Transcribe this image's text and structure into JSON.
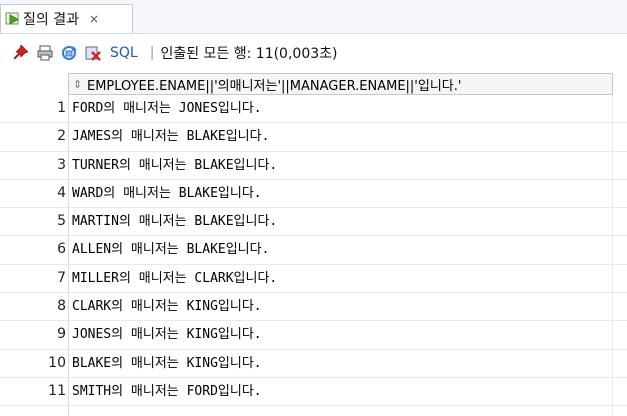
{
  "tab": {
    "label": "질의 결과",
    "close": "×",
    "icon": "run-query-icon"
  },
  "toolbar": {
    "pin_icon": "pin-icon",
    "print_icon": "print-icon",
    "refresh_icon": "refresh-icon",
    "clear_icon": "clear-icon",
    "sql_label": "SQL",
    "separator": "|",
    "status": "인출된 모든 행: 11(0,003초)"
  },
  "grid": {
    "column_header": "EMPLOYEE.ENAME||'의매니저는'||MANAGER.ENAME||'입니다.'",
    "rows": [
      {
        "num": "1",
        "value": "FORD의 매니저는 JONES입니다."
      },
      {
        "num": "2",
        "value": "JAMES의 매니저는 BLAKE입니다."
      },
      {
        "num": "3",
        "value": "TURNER의 매니저는 BLAKE입니다."
      },
      {
        "num": "4",
        "value": "WARD의 매니저는 BLAKE입니다."
      },
      {
        "num": "5",
        "value": "MARTIN의 매니저는 BLAKE입니다."
      },
      {
        "num": "6",
        "value": "ALLEN의 매니저는 BLAKE입니다."
      },
      {
        "num": "7",
        "value": "MILLER의 매니저는 CLARK입니다."
      },
      {
        "num": "8",
        "value": "CLARK의 매니저는 KING입니다."
      },
      {
        "num": "9",
        "value": "JONES의 매니저는 KING입니다."
      },
      {
        "num": "10",
        "value": "BLAKE의 매니저는 KING입니다."
      },
      {
        "num": "11",
        "value": "SMITH의 매니저는 FORD입니다."
      }
    ]
  }
}
